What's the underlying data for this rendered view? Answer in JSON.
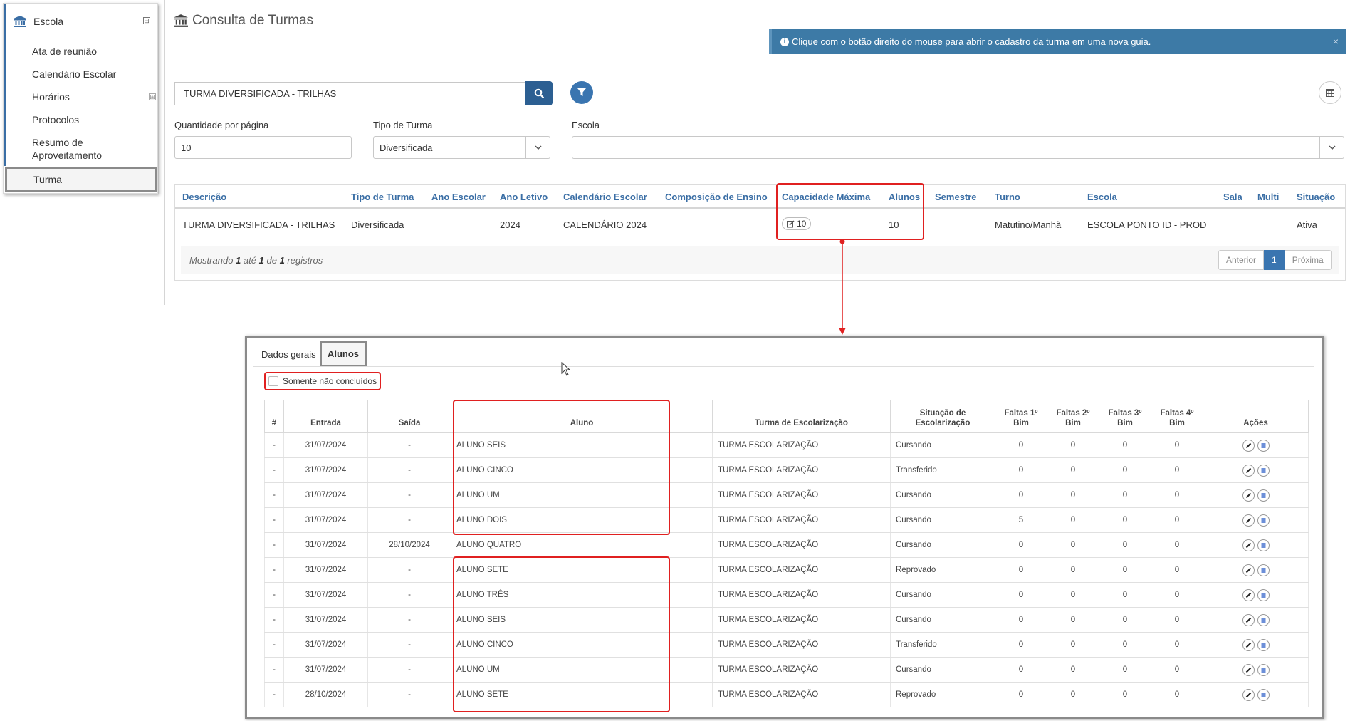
{
  "sidebar": {
    "section_label": "Escola",
    "collapse_symbol": "⊟",
    "expand_symbol": "⊞",
    "icon": "bank-icon",
    "items": [
      {
        "label": "Ata de reunião"
      },
      {
        "label": "Calendário Escolar"
      },
      {
        "label": "Horários"
      },
      {
        "label": "Protocolos"
      },
      {
        "label": "Resumo de Aproveitamento"
      },
      {
        "label": "Turma"
      }
    ]
  },
  "page": {
    "title": "Consulta de Turmas",
    "alert": "Clique com o botão direito do mouse para abrir o cadastro da turma em uma nova guia.",
    "alert_close": "×"
  },
  "search": {
    "value": "TURMA DIVERSIFICADA - TRILHAS"
  },
  "filters": {
    "per_page_label": "Quantidade por página",
    "per_page_value": "10",
    "tipo_label": "Tipo de Turma",
    "tipo_value": "Diversificada",
    "escola_label": "Escola",
    "escola_value": ""
  },
  "results": {
    "headers": [
      "Descrição",
      "Tipo de Turma",
      "Ano Escolar",
      "Ano Letivo",
      "Calendário Escolar",
      "Composição de Ensino",
      "Capacidade Máxima",
      "Alunos",
      "Semestre",
      "Turno",
      "Escola",
      "Sala",
      "Multi",
      "Situação"
    ],
    "row": {
      "descricao": "TURMA DIVERSIFICADA - TRILHAS",
      "tipo": "Diversificada",
      "ano_escolar": "",
      "ano_letivo": "2024",
      "calendario": "CALENDÁRIO 2024",
      "composicao": "",
      "capacidade": "10",
      "alunos": "10",
      "semestre": "",
      "turno": "Matutino/Manhã",
      "escola": "ESCOLA PONTO ID - PROD",
      "sala": "",
      "multi": "",
      "situacao": "Ativa"
    },
    "footer": {
      "prefix": "Mostrando",
      "from": "1",
      "mid1": "até",
      "to": "1",
      "mid2": "de",
      "total": "1",
      "suffix": "registros"
    },
    "pager": {
      "prev": "Anterior",
      "current": "1",
      "next": "Próxima"
    }
  },
  "popup": {
    "tabs": [
      "Dados gerais",
      "Alunos"
    ],
    "checkbox_label": "Somente não concluídos",
    "headers": [
      "#",
      "Entrada",
      "Saída",
      "Aluno",
      "Turma de Escolarização",
      "Situação de Escolarização",
      "Faltas 1º Bim",
      "Faltas 2º Bim",
      "Faltas 3º Bim",
      "Faltas 4º Bim",
      "Ações"
    ],
    "rows": [
      {
        "num": "-",
        "entrada": "31/07/2024",
        "saida": "-",
        "aluno": "ALUNO SEIS",
        "turma": "TURMA ESCOLARIZAÇÃO",
        "situacao": "Cursando",
        "f1": "0",
        "f2": "0",
        "f3": "0",
        "f4": "0"
      },
      {
        "num": "-",
        "entrada": "31/07/2024",
        "saida": "-",
        "aluno": "ALUNO CINCO",
        "turma": "TURMA ESCOLARIZAÇÃO",
        "situacao": "Transferido",
        "f1": "0",
        "f2": "0",
        "f3": "0",
        "f4": "0"
      },
      {
        "num": "-",
        "entrada": "31/07/2024",
        "saida": "-",
        "aluno": "ALUNO UM",
        "turma": "TURMA ESCOLARIZAÇÃO",
        "situacao": "Cursando",
        "f1": "0",
        "f2": "0",
        "f3": "0",
        "f4": "0"
      },
      {
        "num": "-",
        "entrada": "31/07/2024",
        "saida": "-",
        "aluno": "ALUNO DOIS",
        "turma": "TURMA ESCOLARIZAÇÃO",
        "situacao": "Cursando",
        "f1": "5",
        "f2": "0",
        "f3": "0",
        "f4": "0"
      },
      {
        "num": "-",
        "entrada": "31/07/2024",
        "saida": "28/10/2024",
        "aluno": "ALUNO QUATRO",
        "turma": "TURMA ESCOLARIZAÇÃO",
        "situacao": "Cursando",
        "f1": "0",
        "f2": "0",
        "f3": "0",
        "f4": "0"
      },
      {
        "num": "-",
        "entrada": "31/07/2024",
        "saida": "-",
        "aluno": "ALUNO SETE",
        "turma": "TURMA ESCOLARIZAÇÃO",
        "situacao": "Reprovado",
        "f1": "0",
        "f2": "0",
        "f3": "0",
        "f4": "0"
      },
      {
        "num": "-",
        "entrada": "31/07/2024",
        "saida": "-",
        "aluno": "ALUNO TRÊS",
        "turma": "TURMA ESCOLARIZAÇÃO",
        "situacao": "Cursando",
        "f1": "0",
        "f2": "0",
        "f3": "0",
        "f4": "0"
      },
      {
        "num": "-",
        "entrada": "31/07/2024",
        "saida": "-",
        "aluno": "ALUNO SEIS",
        "turma": "TURMA ESCOLARIZAÇÃO",
        "situacao": "Cursando",
        "f1": "0",
        "f2": "0",
        "f3": "0",
        "f4": "0"
      },
      {
        "num": "-",
        "entrada": "31/07/2024",
        "saida": "-",
        "aluno": "ALUNO CINCO",
        "turma": "TURMA ESCOLARIZAÇÃO",
        "situacao": "Transferido",
        "f1": "0",
        "f2": "0",
        "f3": "0",
        "f4": "0"
      },
      {
        "num": "-",
        "entrada": "31/07/2024",
        "saida": "-",
        "aluno": "ALUNO UM",
        "turma": "TURMA ESCOLARIZAÇÃO",
        "situacao": "Cursando",
        "f1": "0",
        "f2": "0",
        "f3": "0",
        "f4": "0"
      },
      {
        "num": "-",
        "entrada": "28/10/2024",
        "saida": "-",
        "aluno": "ALUNO SETE",
        "turma": "TURMA ESCOLARIZAÇÃO",
        "situacao": "Reprovado",
        "f1": "0",
        "f2": "0",
        "f3": "0",
        "f4": "0"
      }
    ]
  },
  "colors": {
    "accent": "#3a6ea5",
    "alert_bg": "#3d7aa6",
    "highlight": "#e02020"
  }
}
